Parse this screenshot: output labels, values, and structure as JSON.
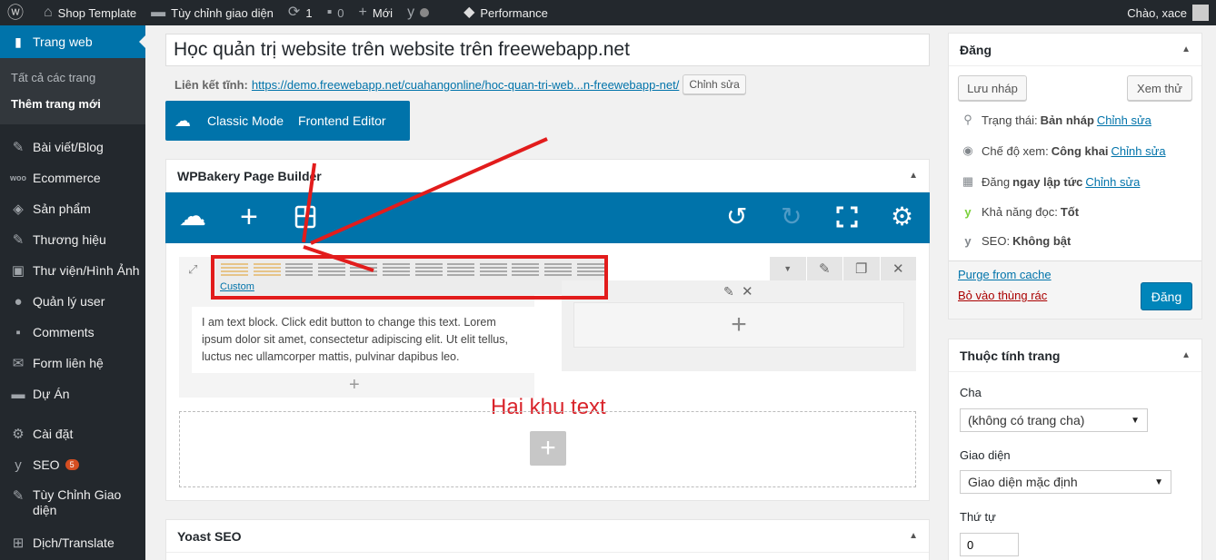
{
  "adminbar": {
    "site_name": "Shop Template",
    "customize": "Tùy chỉnh giao diện",
    "updates": "1",
    "comments": "0",
    "new": "Mới",
    "performance": "Performance",
    "greeting": "Chào, xace"
  },
  "sidebar": {
    "current": "Trang web",
    "sub": [
      "Tất cả các trang",
      "Thêm trang mới"
    ],
    "items": [
      {
        "label": "Bài viết/Blog",
        "icon": "pin-icon"
      },
      {
        "label": "Ecommerce",
        "icon": "woo-icon"
      },
      {
        "label": "Sản phẩm",
        "icon": "box-icon"
      },
      {
        "label": "Thương hiệu",
        "icon": "pin-icon"
      },
      {
        "label": "Thư viện/Hình Ảnh",
        "icon": "media-icon"
      },
      {
        "label": "Quản lý user",
        "icon": "user-icon"
      },
      {
        "label": "Comments",
        "icon": "comment-icon"
      },
      {
        "label": "Form liên hệ",
        "icon": "mail-icon"
      },
      {
        "label": "Dự Án",
        "icon": "folder-icon"
      },
      {
        "label": "Cài đặt",
        "icon": "settings-icon"
      },
      {
        "label": "SEO",
        "icon": "yoast-icon",
        "badge": "5"
      },
      {
        "label": "Tùy Chỉnh Giao",
        "label2": "diện",
        "icon": "tool-icon"
      },
      {
        "label": "Dịch/Translate",
        "icon": "translate-icon"
      }
    ]
  },
  "editor": {
    "title": "Học quản trị website trên website trên freewebapp.net",
    "permalink_label": "Liên kết tĩnh:",
    "permalink_url": "https://demo.freewebapp.net/cuahangonline/hoc-quan-tri-web...n-freewebapp-net/",
    "permalink_edit": "Chỉnh sửa",
    "modes": [
      "Classic Mode",
      "Frontend Editor"
    ]
  },
  "wpbakery": {
    "title": "WPBakery Page Builder",
    "custom_label": "Custom",
    "text_block": "I am text block. Click edit button to change this text. Lorem ipsum dolor sit amet, consectetur adipiscing elit. Ut elit tellus, luctus nec ullamcorper mattis, pulvinar dapibus leo.",
    "annotation": "Hai khu text"
  },
  "yoast": {
    "title": "Yoast SEO"
  },
  "publish": {
    "title": "Đăng",
    "save_draft": "Lưu nháp",
    "preview": "Xem thử",
    "status_label": "Trạng thái:",
    "status_value": "Bản nháp",
    "visibility_label": "Chế độ xem:",
    "visibility_value": "Công khai",
    "schedule_label": "Đăng",
    "schedule_value": "ngay lập tức",
    "edit": "Chỉnh sửa",
    "readability_label": "Khả năng đọc:",
    "readability_value": "Tốt",
    "seo_label": "SEO:",
    "seo_value": "Không bật",
    "purge": "Purge from cache",
    "trash": "Bỏ vào thùng rác",
    "publish_btn": "Đăng"
  },
  "attributes": {
    "title": "Thuộc tính trang",
    "parent_label": "Cha",
    "parent_value": "(không có trang cha)",
    "template_label": "Giao diện",
    "template_value": "Giao diện mặc định",
    "order_label": "Thứ tự",
    "order_value": "0"
  },
  "colors": {
    "accent": "#0073aa",
    "sidebar": "#23282d",
    "annotation": "#e21c1c"
  }
}
